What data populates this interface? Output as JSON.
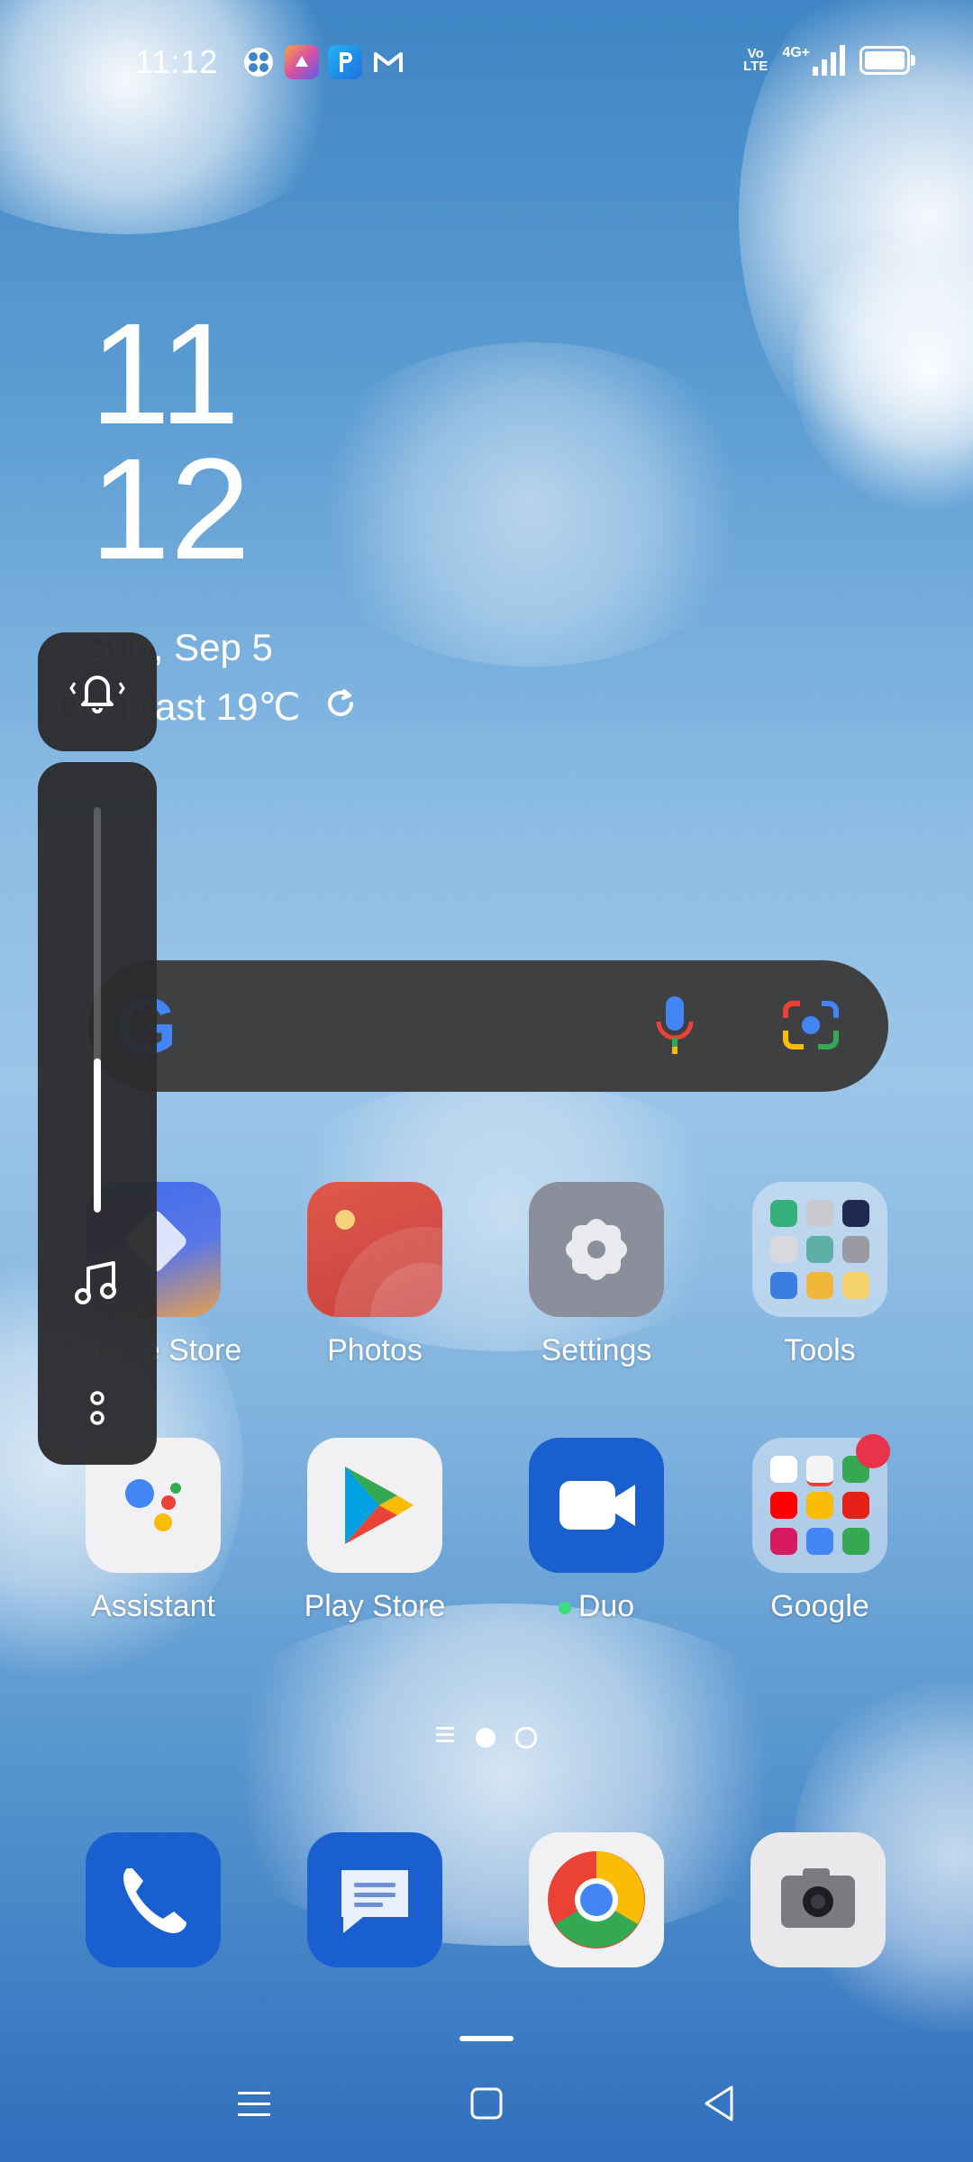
{
  "status_bar": {
    "time": "11:12",
    "notification_icons": [
      "pinwheel-icon",
      "photo-app-icon",
      "paytm-icon",
      "gmail-icon"
    ],
    "network": "4G+",
    "volte": "Vo LTE",
    "battery_level": 0.88
  },
  "clock_widget": {
    "hour": "11",
    "minute": "12",
    "date": "Sun, Sep 5",
    "weather": "Overcast 19℃"
  },
  "volume_panel": {
    "ringer_icon": "vibrate-bell-icon",
    "level": 0.38,
    "stream_icon": "music-note-icon",
    "more_icon": "more-options-icon"
  },
  "search_bar": {
    "logo": "G",
    "voice_icon": "mic-icon",
    "lens_icon": "lens-icon"
  },
  "apps_row1": [
    {
      "label": "Theme Store",
      "icon": "theme-store-icon"
    },
    {
      "label": "Photos",
      "icon": "photos-icon"
    },
    {
      "label": "Settings",
      "icon": "settings-icon"
    },
    {
      "label": "Tools",
      "icon": "tools-folder-icon"
    }
  ],
  "apps_row2": [
    {
      "label": "Assistant",
      "icon": "assistant-icon"
    },
    {
      "label": "Play Store",
      "icon": "play-store-icon"
    },
    {
      "label": "Duo",
      "icon": "duo-icon"
    },
    {
      "label": "Google",
      "icon": "google-folder-icon"
    }
  ],
  "dock": [
    "phone-icon",
    "messages-icon",
    "chrome-icon",
    "camera-icon"
  ],
  "colors": {
    "panel": "#2c2c2e",
    "accent_blue": "#1a5fd0",
    "notification_dot": "#e8334a"
  }
}
